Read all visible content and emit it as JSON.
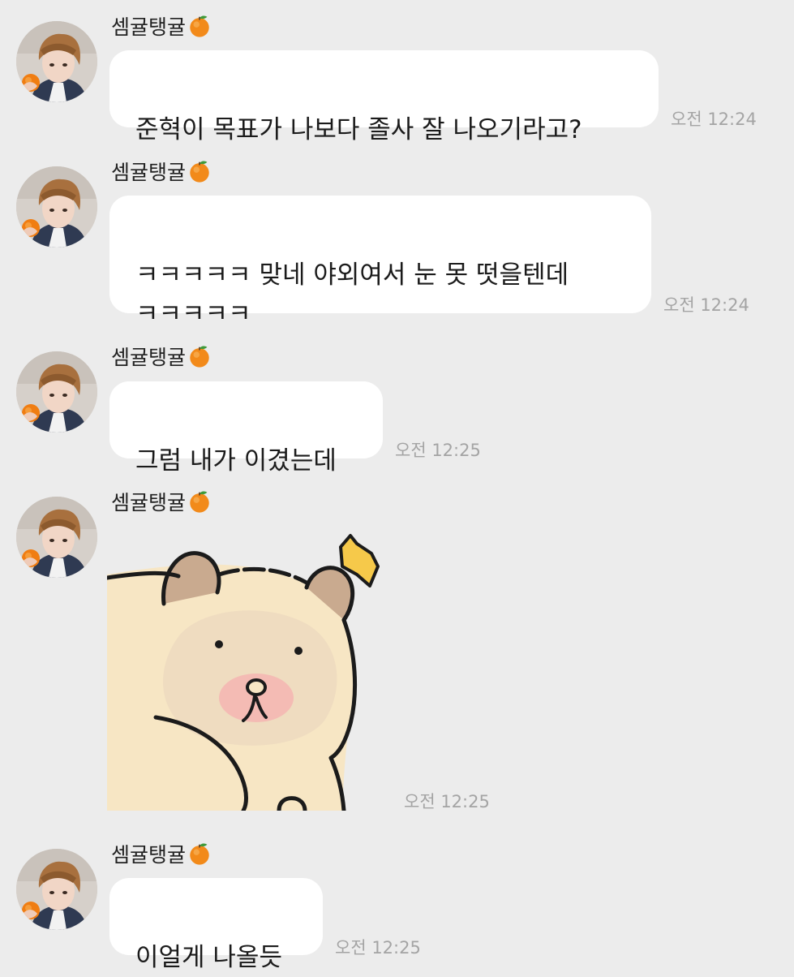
{
  "messages": [
    {
      "sender": "셈귤탱귤",
      "sender_emoji": "orange-icon",
      "type": "text",
      "text": "준혁이 목표가 나보다 졸사 잘 나오기라고?",
      "time": "오전 12:24"
    },
    {
      "sender": "셈귤탱귤",
      "sender_emoji": "orange-icon",
      "type": "text",
      "text": "ㅋㅋㅋㅋㅋ 맞네 야외여서 눈 못 떳을텐데\nㅋㅋㅋㅋㅋ",
      "time": "오전 12:24"
    },
    {
      "sender": "셈귤탱귤",
      "sender_emoji": "orange-icon",
      "type": "text",
      "text": "그럼 내가 이겼는데",
      "time": "오전 12:25"
    },
    {
      "sender": "셈귤탱귤",
      "sender_emoji": "orange-icon",
      "type": "sticker",
      "sticker": "startled-bear-sticker",
      "time": "오전 12:25"
    },
    {
      "sender": "셈귤탱귤",
      "sender_emoji": "orange-icon",
      "type": "text",
      "text": "이얼게 나올듯",
      "time": "오전 12:25"
    }
  ],
  "colors": {
    "background": "#ececec",
    "bubble": "#ffffff",
    "time_text": "#a4a4a4",
    "sticker_bear": "#f7e6c4",
    "sticker_spark": "#f6c94a"
  }
}
